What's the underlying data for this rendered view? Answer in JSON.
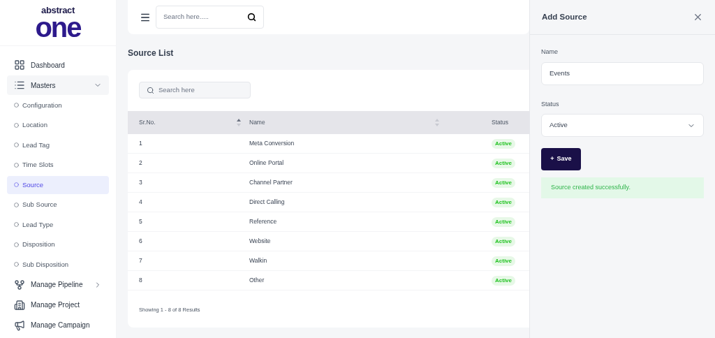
{
  "logo": {
    "top": "abstract",
    "main": "one"
  },
  "sidebar": {
    "items": [
      {
        "label": "Dashboard",
        "kind": "link",
        "selected": false
      },
      {
        "label": "Masters",
        "kind": "group",
        "expanded": true,
        "selected": false,
        "children": [
          {
            "label": "Configuration",
            "selected": false
          },
          {
            "label": "Location",
            "selected": false
          },
          {
            "label": "Lead Tag",
            "selected": false
          },
          {
            "label": "Time Slots",
            "selected": false
          },
          {
            "label": "Source",
            "selected": true
          },
          {
            "label": "Sub Source",
            "selected": false
          },
          {
            "label": "Lead Type",
            "selected": false
          },
          {
            "label": "Disposition",
            "selected": false
          },
          {
            "label": "Sub Disposition",
            "selected": false
          }
        ]
      },
      {
        "label": "Manage Pipeline",
        "kind": "group",
        "expanded": false,
        "selected": false
      },
      {
        "label": "Manage Project",
        "kind": "link",
        "selected": false
      },
      {
        "label": "Manage Campaign",
        "kind": "link",
        "selected": false
      }
    ]
  },
  "topbar": {
    "search_placeholder": "Search here....."
  },
  "page_title": "Source List",
  "table": {
    "search_placeholder": "Search here",
    "columns": [
      {
        "label": "Sr.No.",
        "sorted": true
      },
      {
        "label": "Name",
        "sorted": false
      },
      {
        "label": "Status"
      }
    ],
    "rows": [
      {
        "sr": "1",
        "name": "Meta Conversion",
        "status": "Active"
      },
      {
        "sr": "2",
        "name": "Online Portal",
        "status": "Active"
      },
      {
        "sr": "3",
        "name": "Channel Partner",
        "status": "Active"
      },
      {
        "sr": "4",
        "name": "Direct Calling",
        "status": "Active"
      },
      {
        "sr": "5",
        "name": "Reference",
        "status": "Active"
      },
      {
        "sr": "6",
        "name": "Website",
        "status": "Active"
      },
      {
        "sr": "7",
        "name": "Walkin",
        "status": "Active"
      },
      {
        "sr": "8",
        "name": "Other",
        "status": "Active"
      }
    ],
    "footer": "Showing 1 - 8 of 8 Results"
  },
  "panel": {
    "title": "Add Source",
    "name_label": "Name",
    "name_value": "Events",
    "status_label": "Status",
    "status_value": "Active",
    "save_icon": "+",
    "save_label": "Save",
    "message": "Source created successfully."
  }
}
